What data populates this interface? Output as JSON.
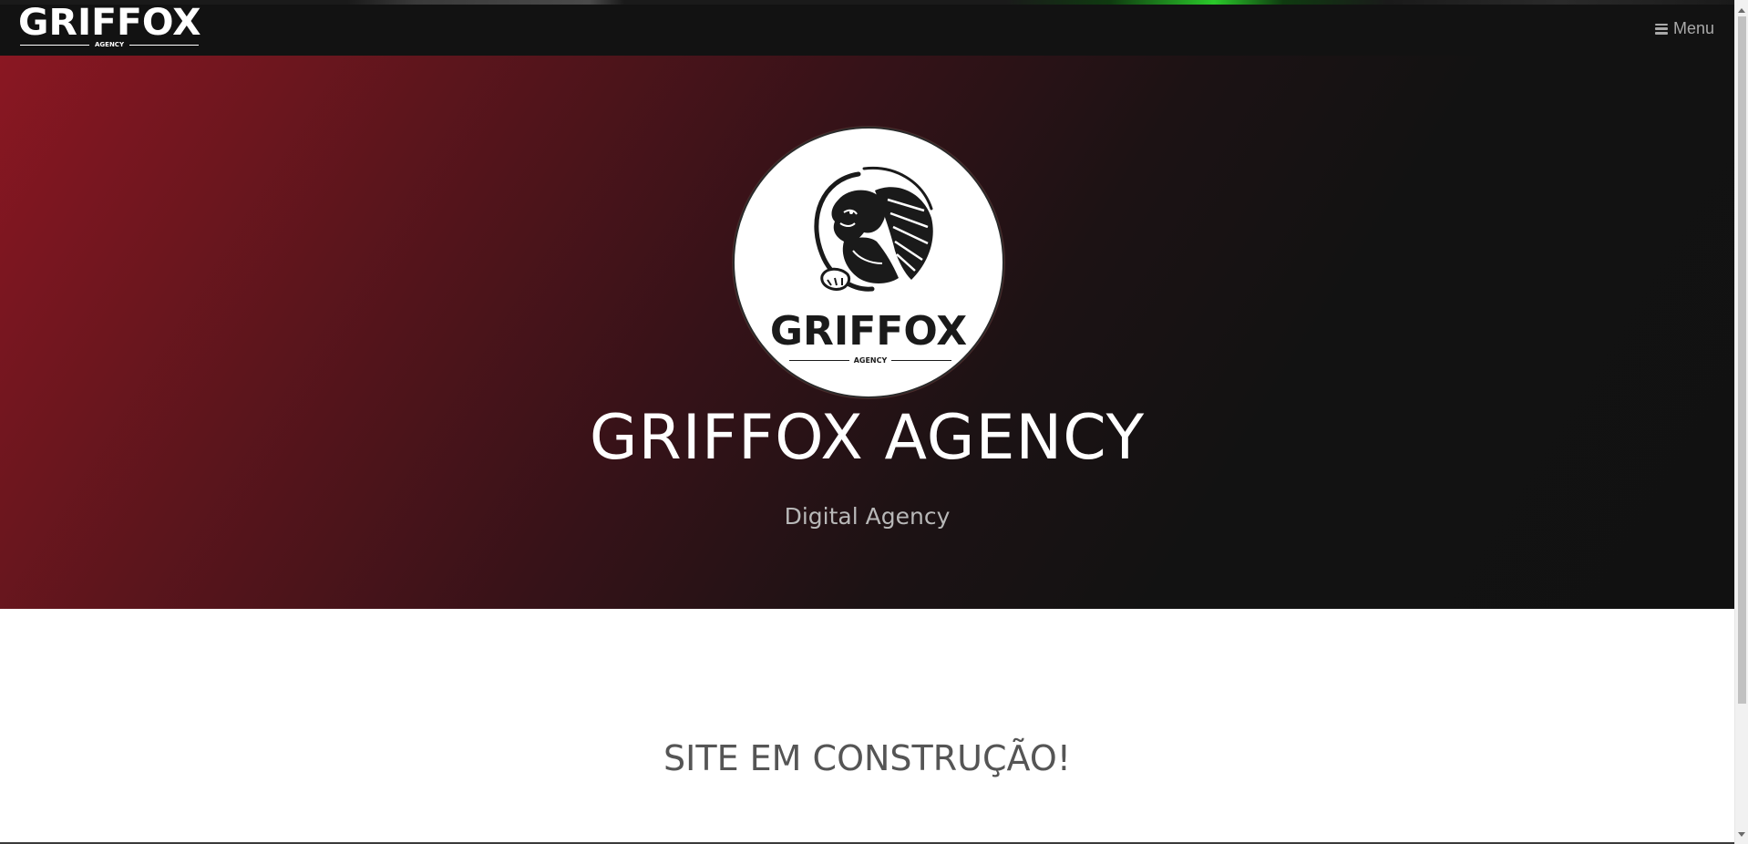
{
  "navbar": {
    "brand": {
      "word": "GRIFFOX",
      "sub": "AGENCY"
    },
    "menu": {
      "icon": "hamburger-icon",
      "label": "Menu"
    }
  },
  "hero": {
    "logo": {
      "icon": "griffin-icon",
      "word": "GRIFFOX",
      "sub": "AGENCY"
    },
    "title": "GRIFFOX AGENCY",
    "subtitle": "Digital Agency"
  },
  "content": {
    "heading": "SITE EM CONSTRUÇÃO!"
  },
  "colors": {
    "navbar_bg": "#121212",
    "hero_gradient_start": "#8a1722",
    "hero_gradient_end": "#111111",
    "menu_text": "#a9a9a9",
    "content_heading": "#555555"
  }
}
